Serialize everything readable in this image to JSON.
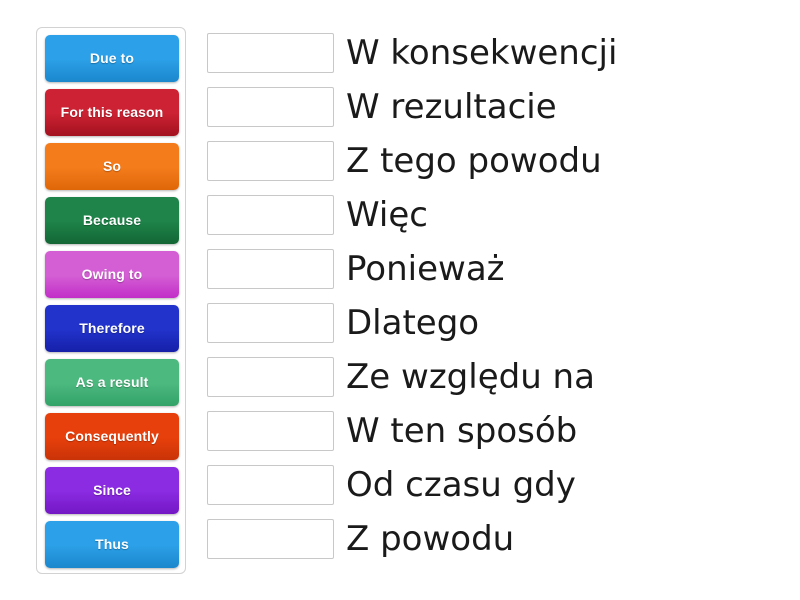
{
  "activity": {
    "type": "match-up",
    "background_color": "#ffffff"
  },
  "tile_panel": {
    "border_color": "#d2d2d2",
    "tiles": [
      {
        "label": "Due to",
        "color": "#2CA0E8",
        "color_dark": "#1B87CC",
        "text_color": "#ffffff",
        "wrap": false
      },
      {
        "label": "For this reason",
        "color": "#CC2233",
        "color_dark": "#A3111F",
        "text_color": "#ffffff",
        "wrap": true
      },
      {
        "label": "So",
        "color": "#F57C1B",
        "color_dark": "#E06708",
        "text_color": "#ffffff",
        "wrap": false
      },
      {
        "label": "Because",
        "color": "#1E8449",
        "color_dark": "#136634",
        "text_color": "#ffffff",
        "wrap": false
      },
      {
        "label": "Owing to",
        "color": "#D45FD4",
        "color_dark": "#C22EC8",
        "text_color": "#ffffff",
        "wrap": false
      },
      {
        "label": "Therefore",
        "color": "#2233CC",
        "color_dark": "#1620A8",
        "text_color": "#ffffff",
        "wrap": false
      },
      {
        "label": "As a result",
        "color": "#4CB97F",
        "color_dark": "#33A368",
        "text_color": "#ffffff",
        "wrap": false
      },
      {
        "label": "Consequently",
        "color": "#E8400C",
        "color_dark": "#C93307",
        "text_color": "#ffffff",
        "wrap": false
      },
      {
        "label": "Since",
        "color": "#8B2BE2",
        "color_dark": "#7317C4",
        "text_color": "#ffffff",
        "wrap": false
      },
      {
        "label": "Thus",
        "color": "#2CA0E8",
        "color_dark": "#1B87CC",
        "text_color": "#ffffff",
        "wrap": false
      }
    ]
  },
  "answers": {
    "box_border_color": "#c8c8c8",
    "text_color": "#1a1a1a",
    "rows": [
      {
        "answer": "",
        "prompt": "W konsekwencji"
      },
      {
        "answer": "",
        "prompt": "W rezultacie"
      },
      {
        "answer": "",
        "prompt": "Z tego powodu"
      },
      {
        "answer": "",
        "prompt": "Więc"
      },
      {
        "answer": "",
        "prompt": "Ponieważ"
      },
      {
        "answer": "",
        "prompt": "Dlatego"
      },
      {
        "answer": "",
        "prompt": "Ze względu na"
      },
      {
        "answer": "",
        "prompt": "W ten sposób"
      },
      {
        "answer": "",
        "prompt": "Od czasu gdy"
      },
      {
        "answer": "",
        "prompt": "Z powodu"
      }
    ]
  }
}
